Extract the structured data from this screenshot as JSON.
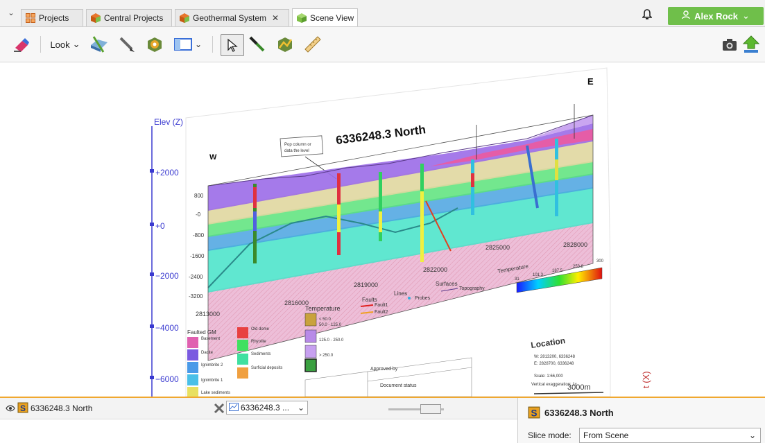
{
  "tabs": [
    {
      "label": "Projects",
      "icon": "projects-grid-icon"
    },
    {
      "label": "Central Projects",
      "icon": "central-cube-icon"
    },
    {
      "label": "Geothermal System",
      "icon": "geothermal-cube-icon",
      "close": "✕"
    },
    {
      "label": "Scene View",
      "icon": "scene-cube-icon"
    }
  ],
  "user": {
    "name": "Alex Rock",
    "icon": "user-icon",
    "chevron": "chevron-down-icon"
  },
  "toolbar": {
    "look_label": "Look",
    "tools": [
      "eraser-icon",
      "slice-icon",
      "pencil-icon",
      "gear-cube-icon",
      "panel-icon",
      "pointer-icon",
      "measure-knife-icon",
      "polyline-icon",
      "ruler-icon",
      "camera-icon",
      "upload-icon"
    ]
  },
  "scene": {
    "compass_w": "W",
    "compass_e": "E",
    "elev_label": "Elev (Z)",
    "elev_ticks": [
      "+2000",
      "+0",
      "−2000",
      "−4000",
      "−6000"
    ],
    "section_title": "6336248.3 North",
    "callout": [
      "Pop column or",
      "data the level"
    ],
    "section_w": "W",
    "left_ticks": [
      "800",
      "-0",
      "-800",
      "-1600",
      "-2400",
      "-3200"
    ],
    "x_ticks": [
      "2813000",
      "2816000",
      "2819000",
      "2822000",
      "2825000",
      "2828000"
    ],
    "temperature_legend": {
      "title": "Temperature",
      "ticks": [
        "31",
        "101.3",
        "187.5",
        "253.8",
        "300"
      ]
    },
    "legend_faults": {
      "title": "Faults",
      "items": [
        "Fault1",
        "Fault2"
      ]
    },
    "legend_lines": {
      "title": "Lines",
      "items": [
        "Probes"
      ]
    },
    "legend_surfaces": {
      "title": "Surfaces",
      "items": [
        "Topography"
      ]
    },
    "legend_temp2": {
      "title": "Temperature",
      "items": [
        "< 50.0",
        "50.0 - 125.0",
        "125.0 - 250.0",
        "> 250.0"
      ]
    },
    "legend_gm": {
      "title": "Faulted GM",
      "items": [
        "Basement",
        "Dacite",
        "Ignimbrite 2",
        "Ignimbrite 1",
        "Lake sediments",
        "Old dome",
        "Rhyolite",
        "Sediments",
        "Surficial deposits"
      ]
    },
    "location": {
      "title": "Location",
      "lines": [
        "W: 2813200, 6336248",
        "E: 2828700, 6336248",
        "Scale: 1:66,000",
        "Vertical exaggeration: 1x"
      ],
      "scale": "3000m"
    },
    "approved_label": "Approved by",
    "status_label": "Document status",
    "axis_x_label": "t (X)"
  },
  "bottom_left": {
    "item_label": "6336248.3 North",
    "slice_dropdown": "6336248.3 ..."
  },
  "bottom_right": {
    "title": "6336248.3 North",
    "slice_mode_label": "Slice mode:",
    "slice_mode_value": "From Scene"
  }
}
